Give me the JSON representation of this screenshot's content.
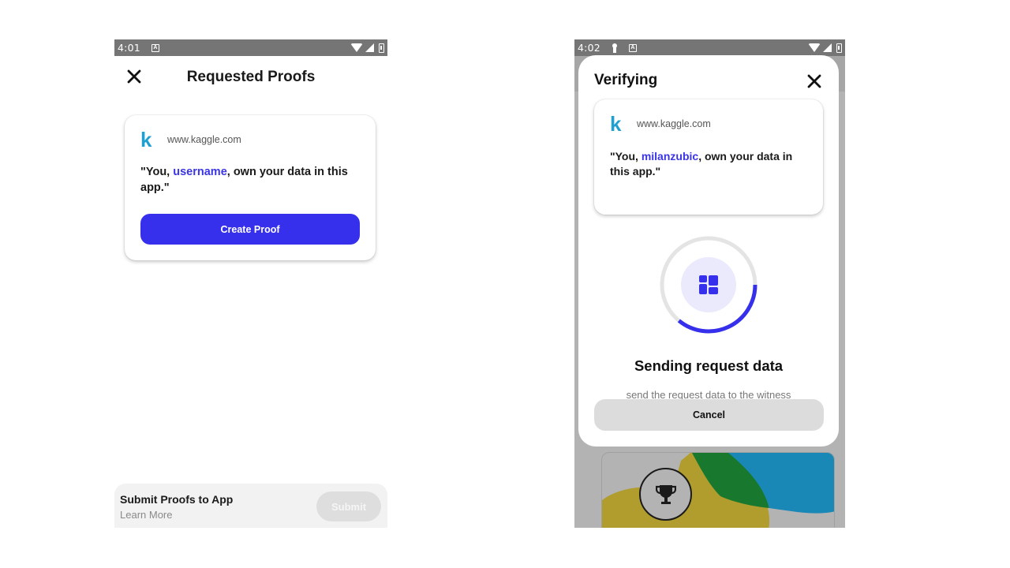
{
  "left_screen": {
    "statusbar": {
      "time": "4:01",
      "notification_icon": "a-notification-icon",
      "icons": [
        "wifi-icon",
        "signal-icon",
        "battery-icon"
      ]
    },
    "header": {
      "title": "Requested Proofs",
      "close_icon": "close-icon"
    },
    "proof_card": {
      "logo_letter": "k",
      "site": "www.kaggle.com",
      "claim_prefix": "\"You, ",
      "claim_user": "username",
      "claim_suffix": ", own your data in this app.\"",
      "button_label": "Create Proof"
    },
    "footer": {
      "title": "Submit Proofs to App",
      "link": "Learn More",
      "submit_label": "Submit",
      "submit_enabled": false
    }
  },
  "right_screen": {
    "statusbar": {
      "time": "4:02",
      "notification_icons": [
        "key-icon",
        "a-notification-icon"
      ],
      "icons": [
        "wifi-icon",
        "signal-icon",
        "battery-icon"
      ]
    },
    "modal": {
      "title": "Verifying",
      "close_icon": "close-icon",
      "proof_card": {
        "logo_letter": "k",
        "site": "www.kaggle.com",
        "claim_prefix": "\"You, ",
        "claim_user": "milanzubic",
        "claim_suffix": ", own your data in this app.\""
      },
      "progress": {
        "fraction": 0.36,
        "icon": "dashboard-icon"
      },
      "status_title": "Sending request data",
      "status_description": "send the request data to the witness",
      "cancel_label": "Cancel"
    },
    "background": {
      "badge_icon": "trophy-icon"
    }
  },
  "colors": {
    "accent": "#3630ec",
    "username": "#3a35e6",
    "kaggle": "#20a0d0",
    "progress_track": "#e4e4e4",
    "progress_icon_bg": "#ebeafd",
    "statusbar": "#757575"
  }
}
